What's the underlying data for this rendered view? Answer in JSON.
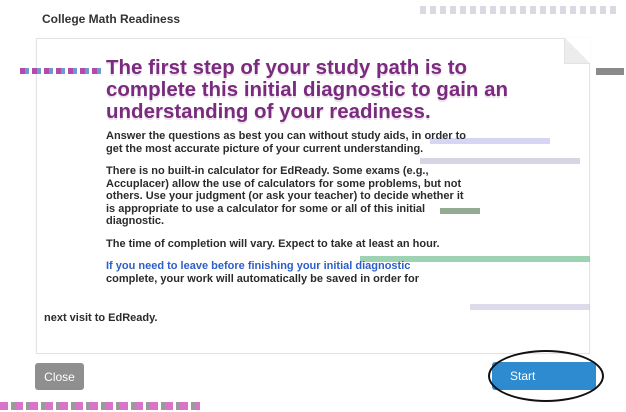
{
  "app": {
    "title": "College Math Readiness"
  },
  "dialog": {
    "headline": "The first step of your study path is to complete this initial diagnostic to gain an understanding of your readiness.",
    "paragraphs": [
      {
        "text": "Answer the questions as best you can without study aids, in order to get the most accurate picture of your current understanding."
      },
      {
        "text": "There is no built-in calculator for EdReady. Some exams (e.g., Accuplacer) allow the use of calculators for some problems, but not others. Use your judgment (or ask your teacher) to decide whether it is appropriate to use a calculator for some or all of this initial diagnostic."
      },
      {
        "text": "The time of completion will vary. Expect to take at least an hour."
      }
    ],
    "link_text": "If you need to leave before finishing your initial diagnostic",
    "continuation": "complete, your work will automatically be saved in order for",
    "next_line": "next visit to EdReady."
  },
  "footer": {
    "close_label": "Close",
    "start_label": "Start"
  },
  "colors": {
    "headline": "#7a2b7e",
    "link": "#2c5ec9",
    "start_button": "#2f8bd0",
    "close_button": "#8f8f8f"
  }
}
